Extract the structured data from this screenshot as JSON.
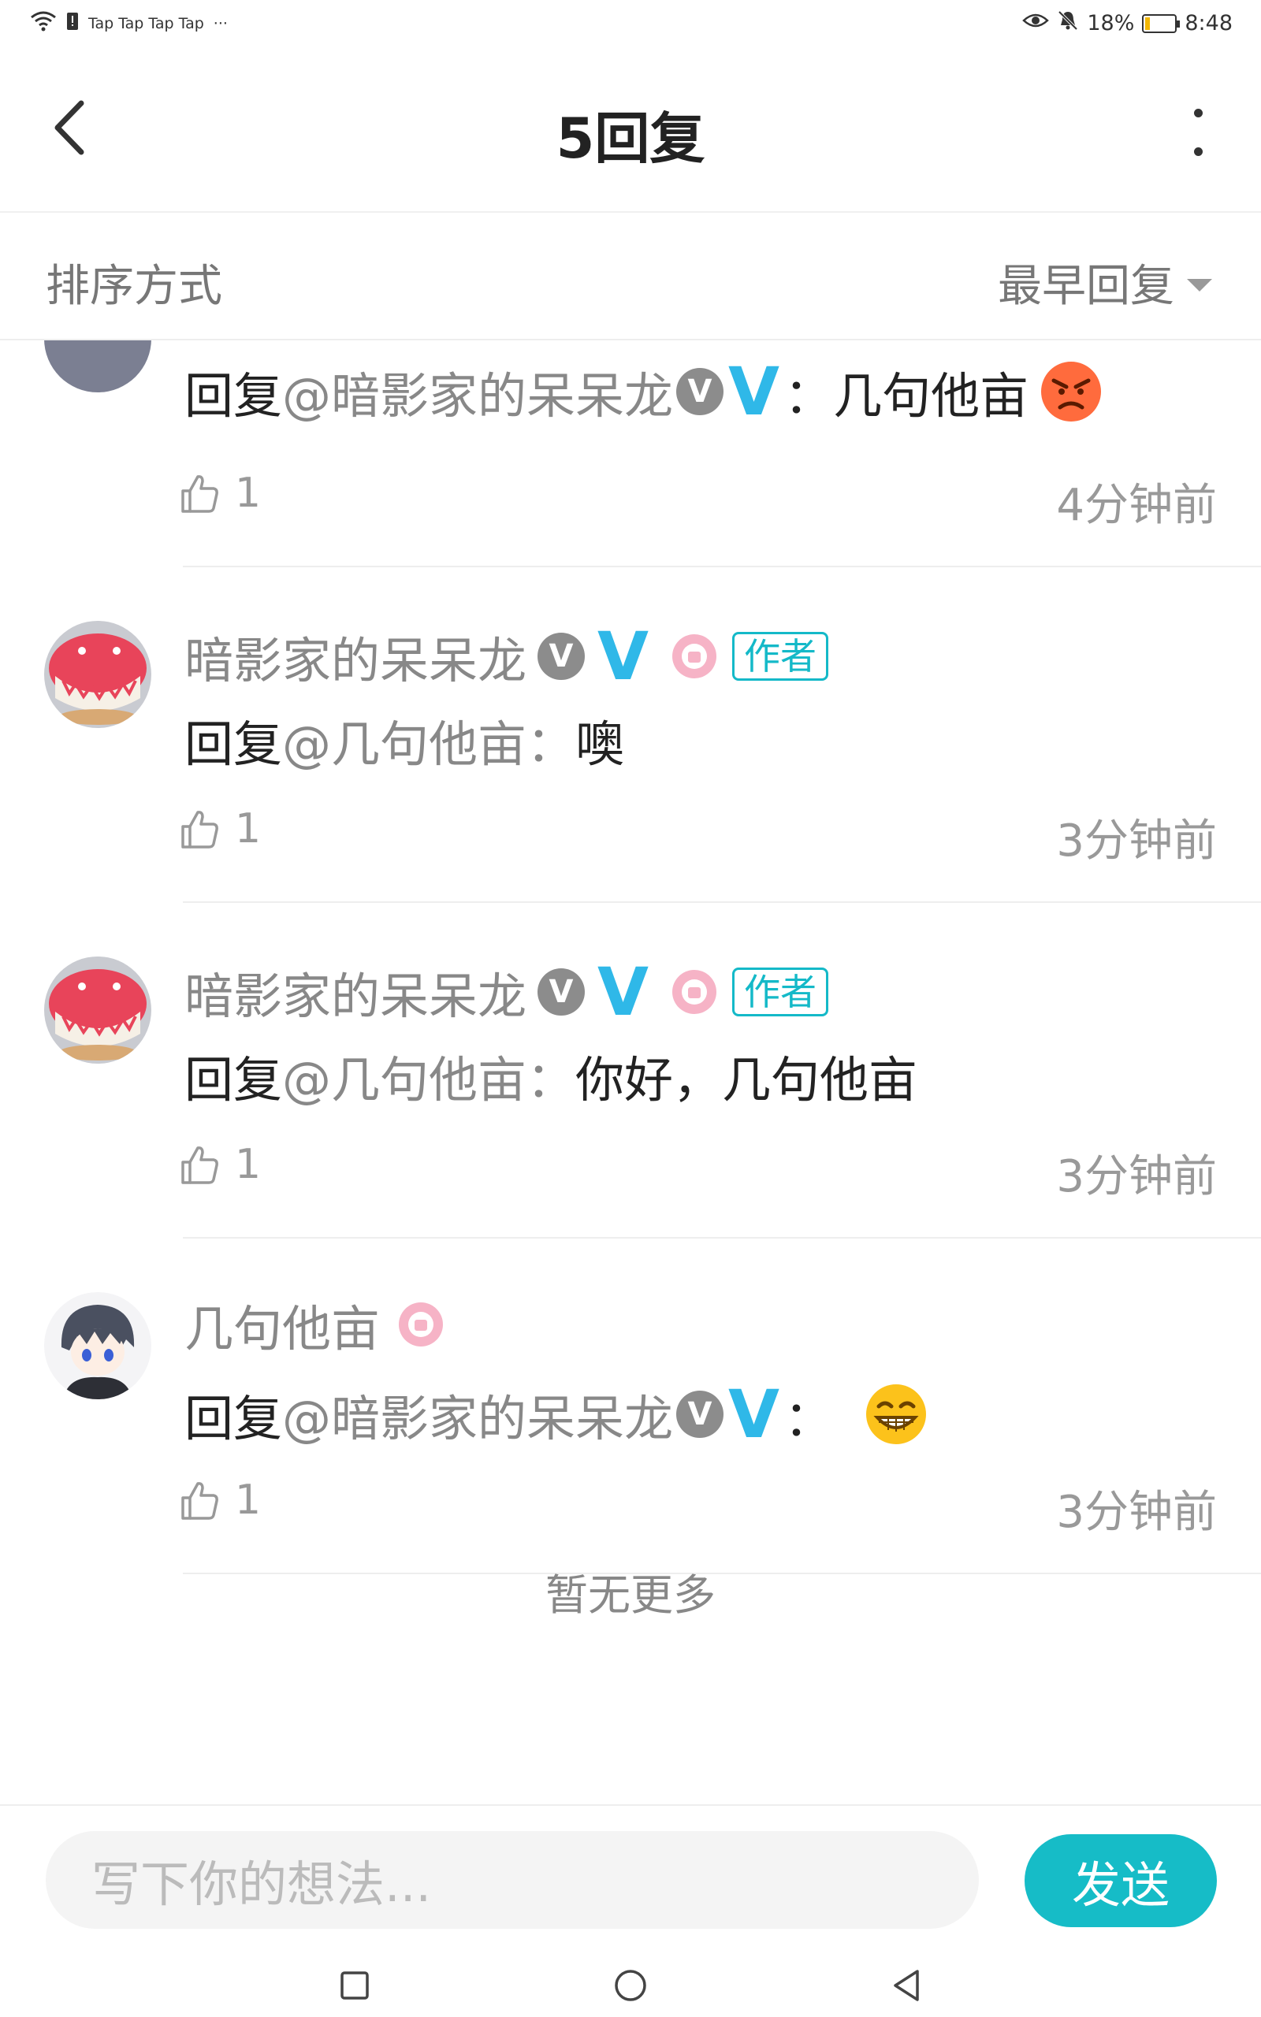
{
  "status_bar": {
    "notifications": "Tap Tap Tap Tap",
    "overflow": "···",
    "battery": "18%",
    "battery_level": 0.18,
    "time": "8:48"
  },
  "header": {
    "title": "5回复"
  },
  "sort": {
    "label": "排序方式",
    "selected": "最早回复"
  },
  "replies": [
    {
      "content_prefix": "回复",
      "mention": "@暗影家的呆呆龙",
      "colon": "：",
      "text": "几句他亩",
      "emoji": "angry-face",
      "likes": "1",
      "time": "4分钟前"
    },
    {
      "username": "暗影家的呆呆龙",
      "v_badge": "V",
      "big_v": "V",
      "author_tag": "作者",
      "content_prefix": "回复",
      "mention": "@几句他亩",
      "colon": "：",
      "text": "噢",
      "likes": "1",
      "time": "3分钟前"
    },
    {
      "username": "暗影家的呆呆龙",
      "v_badge": "V",
      "big_v": "V",
      "author_tag": "作者",
      "content_prefix": "回复",
      "mention": "@几句他亩",
      "colon": "：",
      "text": "你好，几句他亩",
      "likes": "1",
      "time": "3分钟前"
    },
    {
      "username": "几句他亩",
      "content_prefix": "回复",
      "mention": "@暗影家的呆呆龙",
      "v_badge": "V",
      "big_v": "V",
      "colon": "：",
      "emoji": "grinning-face",
      "likes": "1",
      "time": "3分钟前"
    }
  ],
  "end_text": "暂无更多",
  "composer": {
    "placeholder": "写下你的想法...",
    "send_label": "发送"
  },
  "colors": {
    "accent": "#16bcc7",
    "big_v": "#2fb8e8",
    "author_tag": "#14b9c8"
  }
}
